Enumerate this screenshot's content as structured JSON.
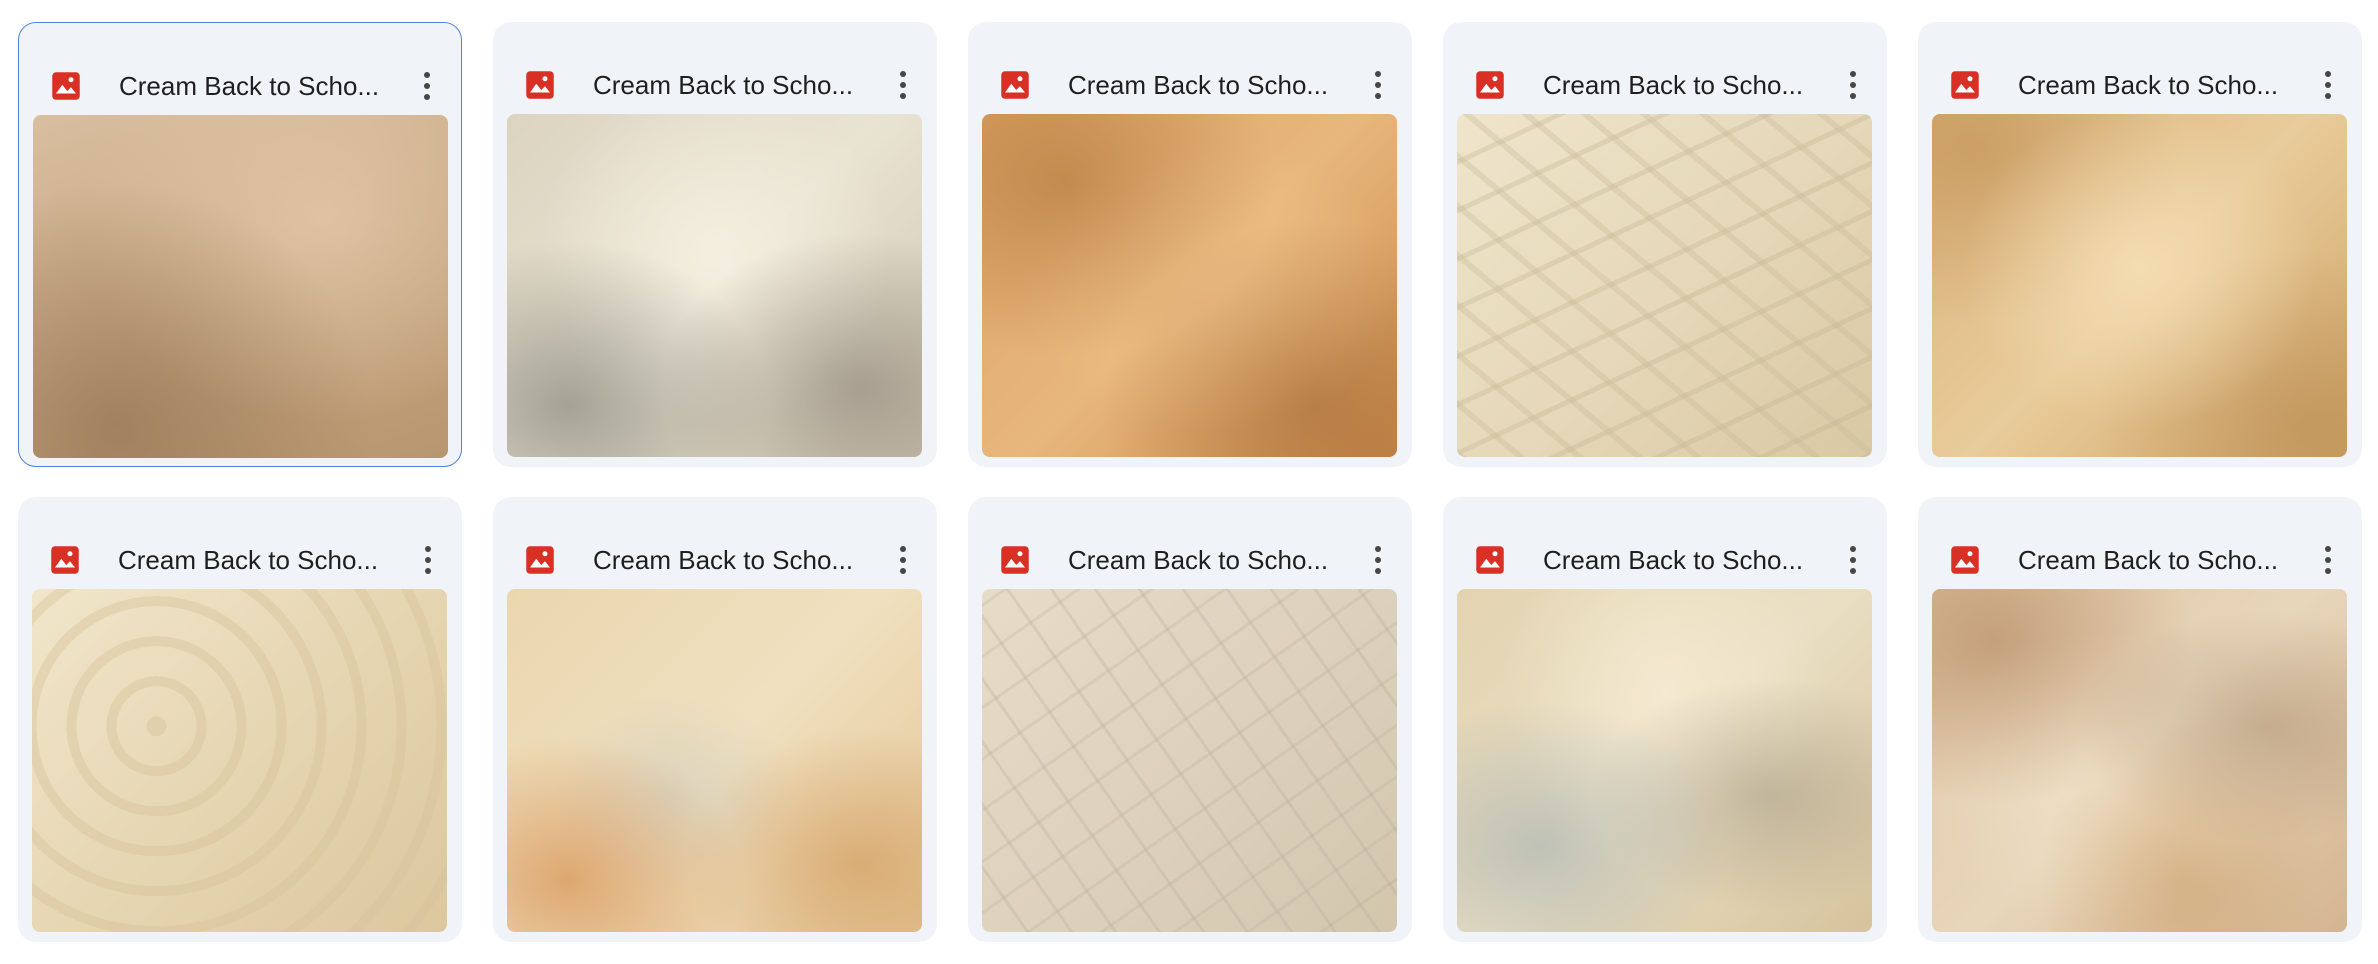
{
  "files": [
    {
      "title": "Cream Back to Scho...",
      "icon": "image-file-icon",
      "selected": true,
      "thumb": "t1"
    },
    {
      "title": "Cream Back to Scho...",
      "icon": "image-file-icon",
      "selected": false,
      "thumb": "t2"
    },
    {
      "title": "Cream Back to Scho...",
      "icon": "image-file-icon",
      "selected": false,
      "thumb": "t3"
    },
    {
      "title": "Cream Back to Scho...",
      "icon": "image-file-icon",
      "selected": false,
      "thumb": "t4"
    },
    {
      "title": "Cream Back to Scho...",
      "icon": "image-file-icon",
      "selected": false,
      "thumb": "t5"
    },
    {
      "title": "Cream Back to Scho...",
      "icon": "image-file-icon",
      "selected": false,
      "thumb": "t6"
    },
    {
      "title": "Cream Back to Scho...",
      "icon": "image-file-icon",
      "selected": false,
      "thumb": "t7"
    },
    {
      "title": "Cream Back to Scho...",
      "icon": "image-file-icon",
      "selected": false,
      "thumb": "t8"
    },
    {
      "title": "Cream Back to Scho...",
      "icon": "image-file-icon",
      "selected": false,
      "thumb": "t9"
    },
    {
      "title": "Cream Back to Scho...",
      "icon": "image-file-icon",
      "selected": false,
      "thumb": "t10"
    }
  ],
  "colors": {
    "icon_red": "#d93025",
    "selection_border": "#4f83dc",
    "card_bg": "#f0f4f9"
  }
}
